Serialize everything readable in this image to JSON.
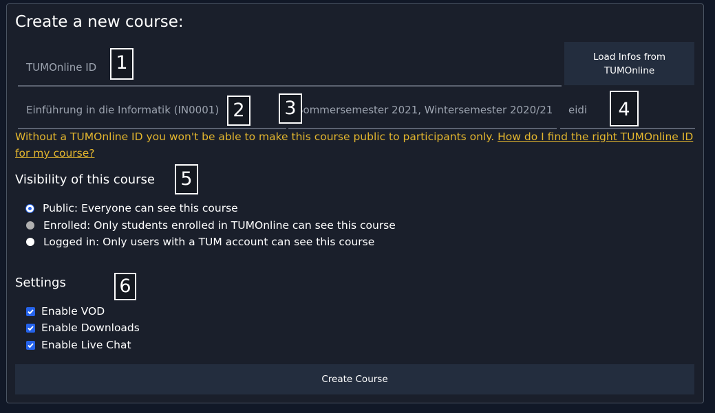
{
  "page_title": "Create a new course:",
  "fields": {
    "tumonline_id": "TUMOnline ID",
    "course_name": "Einführung in die Informatik (IN0001)",
    "semester": "Sommersemester 2021, Wintersemester 2020/21",
    "slug": "eidi"
  },
  "load_button": {
    "line1": "Load Infos from",
    "line2": "TUMOnline"
  },
  "warning": {
    "text": "Without a TUMOnline ID you won't be able to make this course public to participants only. ",
    "link": "How do I find the right TUMOnline ID for my course?"
  },
  "visibility": {
    "heading": "Visibility of this course",
    "options": [
      {
        "label": "Public: Everyone can see this course",
        "state": "selected"
      },
      {
        "label": "Enrolled: Only students enrolled in TUMOnline can see this course",
        "state": "disabled"
      },
      {
        "label": "Logged in: Only users with a TUM account can see this course",
        "state": "unselected"
      }
    ]
  },
  "settings": {
    "heading": "Settings",
    "options": [
      {
        "label": "Enable VOD",
        "checked": true
      },
      {
        "label": "Enable Downloads",
        "checked": true
      },
      {
        "label": "Enable Live Chat",
        "checked": true
      }
    ]
  },
  "create_button": "Create Course",
  "markers": [
    "1",
    "2",
    "3",
    "4",
    "5",
    "6"
  ],
  "colors": {
    "accent": "#2563eb",
    "warning": "#e3b62e",
    "panel": "#1a1f2b",
    "button": "#232d3e"
  }
}
